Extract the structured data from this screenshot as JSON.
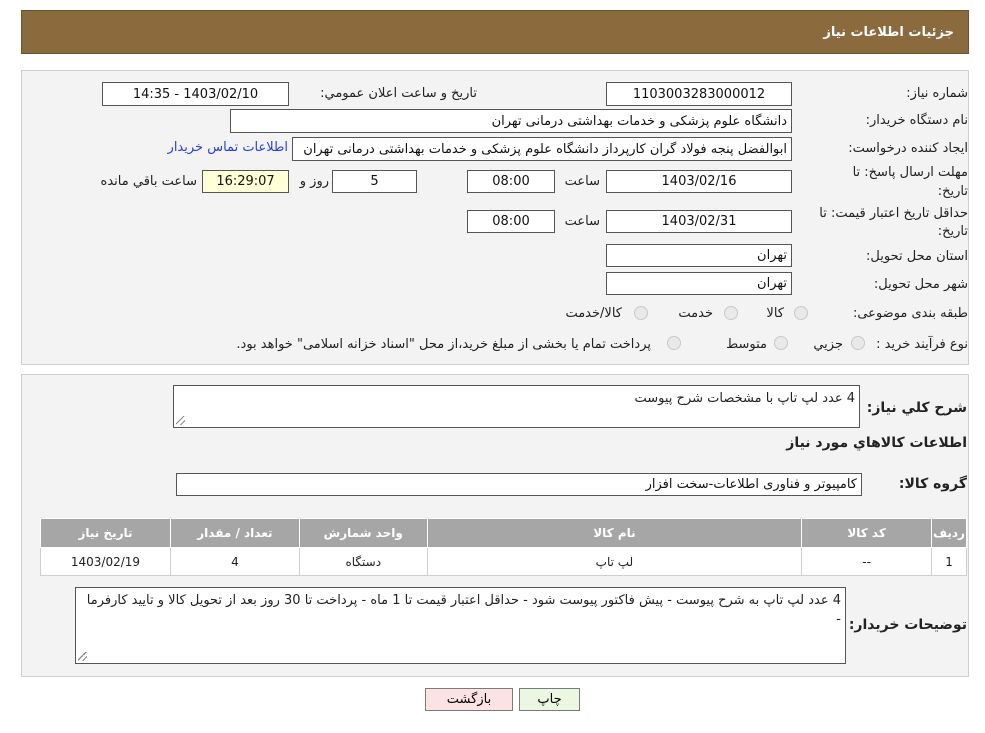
{
  "header": {
    "title": "جزئیات اطلاعات نیاز"
  },
  "fields": {
    "need_number_label": "شماره نیاز:",
    "need_number": "1103003283000012",
    "announce_label": "تاریخ و ساعت اعلان عمومي:",
    "announce_value": "1403/02/10 - 14:35",
    "buyer_org_label": "نام دستگاه خريدار:",
    "buyer_org": "دانشگاه علوم پزشکی و خدمات بهداشتی درمانی تهران",
    "creator_label": "ايجاد کننده درخواست:",
    "creator": "ابوالفضل  پنجه فولاد گران  کارپرداز دانشگاه علوم پزشکی و خدمات بهداشتی درمانی تهران",
    "contact_link": "اطلاعات تماس خريدار",
    "reply_deadline_label_1": "مهلت ارسال پاسخ: تا",
    "reply_deadline_label_2": "تاريخ:",
    "reply_date": "1403/02/16",
    "time_label": "ساعت",
    "reply_time": "08:00",
    "days_value": "5",
    "days_label": "روز و",
    "remaining_time": "16:29:07",
    "remaining_label": "ساعت باقي مانده",
    "price_validity_label_1": "حداقل تاريخ اعتبار قيمت: تا",
    "price_validity_label_2": "تاريخ:",
    "price_date": "1403/02/31",
    "price_time": "08:00",
    "province_label": "استان محل تحويل:",
    "province": "تهران",
    "city_label": "شهر محل تحويل:",
    "city": "تهران",
    "category_label": "طبقه بندی موضوعی:",
    "category_options": [
      "کالا",
      "خدمت",
      "کالا/خدمت"
    ],
    "process_label": "نوع فرآيند خريد :",
    "process_options": [
      "جزيي",
      "متوسط"
    ],
    "process_note": "پرداخت تمام يا بخشی از مبلغ خريد،از محل \"اسناد خزانه اسلامی\" خواهد بود."
  },
  "details": {
    "summary_label": "شرح کلي نياز:",
    "summary": "4 عدد لپ تاپ با مشخصات  شرح پیوست",
    "goods_heading": "اطلاعات کالاهاي مورد نياز",
    "group_label": "گروه کالا:",
    "group": "کامپیوتر و فناوری اطلاعات-سخت افزار",
    "table": {
      "headers": [
        "رديف",
        "کد کالا",
        "نام کالا",
        "واحد شمارش",
        "تعداد / مقدار",
        "تاريخ نياز"
      ],
      "rows": [
        [
          "1",
          "--",
          "لپ تاپ",
          "دستگاه",
          "4",
          "1403/02/19"
        ]
      ]
    },
    "buyer_notes_label": "توضيحات خريدار:",
    "buyer_notes": "4 عدد لپ تاپ به شرح پیوست - پیش فاکتور پیوست شود - حداقل اعتبار قیمت تا 1 ماه - پرداخت تا 30 روز بعد از تحویل کالا و تایید کارفرما -"
  },
  "buttons": {
    "print": "چاپ",
    "back": "بازگشت"
  },
  "colors": {
    "header": "#8b6a3d",
    "print_btn": "#eaf7e1",
    "back_btn": "#fbe3e3",
    "link": "#2a3fd6"
  }
}
